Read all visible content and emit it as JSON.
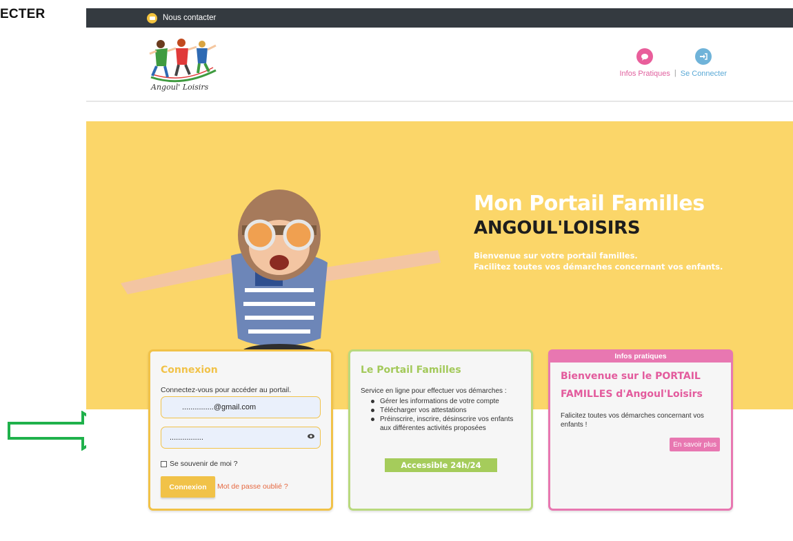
{
  "page": {
    "side_label": "ECTER"
  },
  "topbar": {
    "contact_label": "Nous contacter"
  },
  "nav": {
    "infos_label": "Infos Pratiques",
    "separator": "|",
    "connect_label": "Se Connecter"
  },
  "hero": {
    "title1": "Mon Portail Familles",
    "title2": "ANGOUL'LOISIRS",
    "subtitle1": "Bienvenue sur votre portail familles.",
    "subtitle2": "Facilitez toutes vos démarches concernant vos enfants."
  },
  "login_card": {
    "title": "Connexion",
    "intro": "Connectez-vous pour accéder au portail.",
    "email_value": "...............@gmail.com",
    "password_value": "................",
    "remember_label": "Se souvenir de moi ?",
    "submit_label": "Connexion",
    "forgot_label": "Mot de passe oublié ?"
  },
  "portail_card": {
    "title": "Le Portail Familles",
    "intro": "Service en ligne pour effectuer vos démarches :",
    "items": [
      "Gérer les informations de votre compte",
      "Télécharger vos attestations",
      "Préinscrire, inscrire, désinscrire vos enfants aux différentes activités proposées"
    ],
    "badge": "Accessible 24h/24"
  },
  "infos_card": {
    "header": "Infos pratiques",
    "title": "Bienvenue sur le PORTAIL FAMILLES d'Angoul'Loisirs",
    "description": "Falicitez  toutes vos démarches concernant vos enfants !",
    "button_label": "En savoir plus"
  },
  "colors": {
    "topbar": "#343a40",
    "hero_bg": "#fbd669",
    "login_accent": "#f1c248",
    "portail_accent": "#a5cc5b",
    "infos_accent": "#e877b1",
    "arrow": "#1fb14b"
  },
  "icons": {
    "contact": "mail-icon",
    "infos": "chat-bubble-icon",
    "connect": "sign-in-icon",
    "password_toggle": "eye-icon"
  }
}
